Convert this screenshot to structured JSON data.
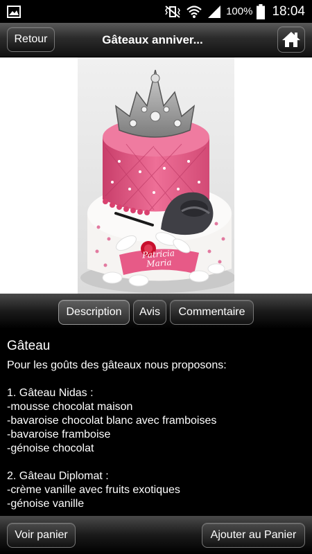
{
  "status_bar": {
    "battery_percent": "100%",
    "time": "18:04",
    "icons": [
      "gallery-icon",
      "vibrate-mute-icon",
      "wifi-icon",
      "signal-icon",
      "battery-icon"
    ]
  },
  "header": {
    "back_label": "Retour",
    "title": "Gâteaux anniver...",
    "home_icon": "home-icon"
  },
  "product_image": {
    "name_on_cake": [
      "Patricia",
      "Maria"
    ]
  },
  "tabs": [
    {
      "label": "Description",
      "active": true
    },
    {
      "label": "Avis",
      "active": false
    },
    {
      "label": "Commentaire",
      "active": false
    }
  ],
  "description": {
    "heading": "Gâteau",
    "lines": [
      "Pour les goûts des gâteaux nous proposons:",
      "",
      "1. Gâteau Nidas :",
      "-mousse chocolat maison",
      "-bavaroise chocolat blanc avec framboises",
      "-bavaroise framboise",
      "-génoise chocolat",
      "",
      "2. Gâteau Diplomat :",
      "-crème vanille avec fruits exotiques",
      "-génoise vanille"
    ]
  },
  "footer": {
    "view_cart_label": "Voir panier",
    "add_to_cart_label": "Ajouter au Panier"
  },
  "colors": {
    "cake_pink": "#e14f7d",
    "cake_white": "#f4f2f0",
    "tiara_silver": "#9b9b9b",
    "shoe": "#3f3f45",
    "rose": "#c8102e"
  }
}
